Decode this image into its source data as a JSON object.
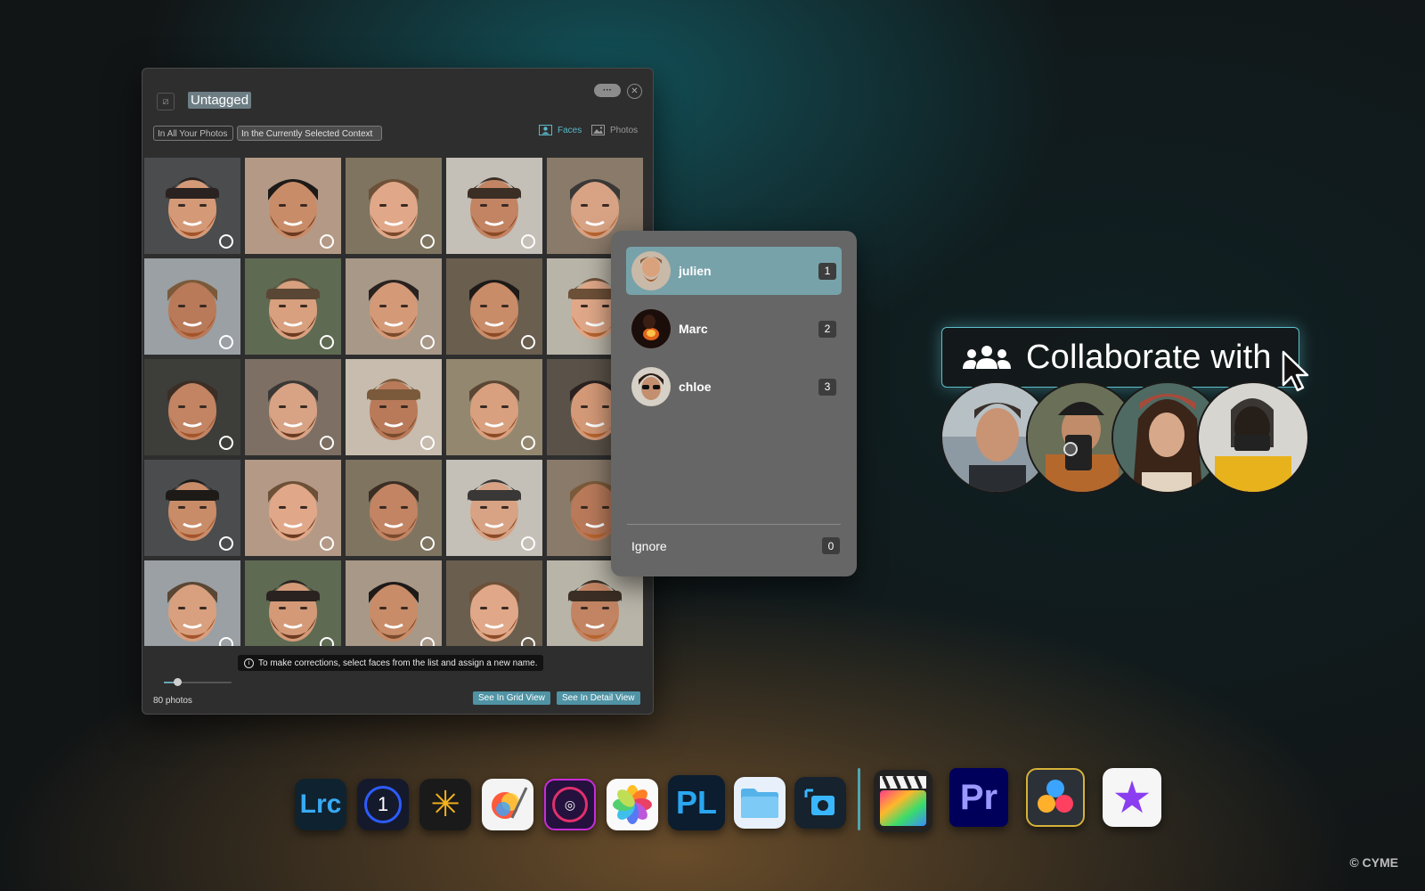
{
  "panel": {
    "title": "Untagged",
    "scope_all": "In All Your Photos",
    "scope_context": "In the Currently Selected Context",
    "view_faces": "Faces",
    "view_photos": "Photos",
    "more_label": "···",
    "close_label": "✕",
    "hint": "To make corrections, select faces from the list and assign a new name.",
    "photo_count": "80 photos",
    "grid_button": "See In Grid View",
    "detail_button": "See In Detail View",
    "zoom_level": 0.2
  },
  "assign_menu": {
    "people": [
      {
        "name": "julien",
        "shortcut": "1",
        "selected": true
      },
      {
        "name": "Marc",
        "shortcut": "2",
        "selected": false
      },
      {
        "name": "chloe",
        "shortcut": "3",
        "selected": false
      }
    ],
    "ignore_label": "Ignore",
    "ignore_shortcut": "0"
  },
  "collaborate": {
    "label": "Collaborate with",
    "icon": "people-group-icon"
  },
  "dock": {
    "apps": [
      {
        "name": "Lightroom Classic",
        "label": "Lrc"
      },
      {
        "name": "Capture One",
        "label": "1"
      },
      {
        "name": "Luminar",
        "label": "✳"
      },
      {
        "name": "Pixelmator Pro",
        "label": ""
      },
      {
        "name": "Aperture-style camera",
        "label": "◎"
      },
      {
        "name": "Photos",
        "label": ""
      },
      {
        "name": "DxO PhotoLab",
        "label": "PL"
      },
      {
        "name": "Finder Folder",
        "label": ""
      },
      {
        "name": "Screenshot app",
        "label": ""
      },
      {
        "name": "Final Cut Pro",
        "label": ""
      },
      {
        "name": "Premiere Pro",
        "label": "Pr"
      },
      {
        "name": "DaVinci Resolve",
        "label": ""
      },
      {
        "name": "iMovie",
        "label": "★"
      }
    ]
  },
  "copyright": "© CYME"
}
